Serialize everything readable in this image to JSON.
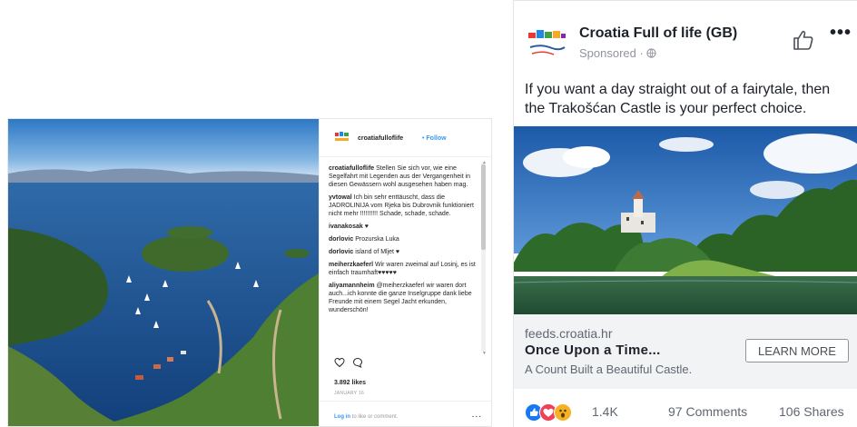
{
  "instagram": {
    "username": "croatiafulloflife",
    "follow_label": "Follow",
    "comments": [
      {
        "user": "croatiafulloflife",
        "text": "Stellen Sie sich vor, wie eine Segelfahrt mit Legenden aus der Vergangenheit in diesen Gewässern wohl ausgesehen haben mag."
      },
      {
        "user": "yvtowal",
        "text": "Ich bin sehr enttäuscht, dass die JADROLINIJA vom Rjeka bis Dubrovnik funktioniert nicht mehr !!!!!!!!!! Schade, schade, schade."
      },
      {
        "user": "ivanakosak",
        "text": "♥"
      },
      {
        "user": "dorlovic",
        "text": "Prozurska Luka"
      },
      {
        "user": "dorlovic",
        "text": "island of Mljet ♥"
      },
      {
        "user": "meiherzkaeferl",
        "text": "Wir waren zweimal auf Losinj, es ist einfach traumhaft♥♥♥♥♥"
      },
      {
        "user": "aliyamannheim",
        "text": "@meiherzkaeferl wir waren dort auch...ich konnte die ganze Inselgruppe dank liebe Freunde mit einem Segel Jacht erkunden, wunderschön!"
      }
    ],
    "likes": "3.892 likes",
    "date": "JANUARY 16",
    "login_link": "Log in",
    "login_rest": " to like or comment.",
    "more": "..."
  },
  "facebook": {
    "page_name": "Croatia Full of life (GB)",
    "sponsored": "Sponsored · ",
    "post_text": "If you want a day straight out of a fairytale, then the Trakošćan Castle is your perfect choice.",
    "link_domain": "feeds.croatia.hr",
    "link_headline": "Once Upon a Time...",
    "link_description": "A Count Built a Beautiful Castle.",
    "cta_label": "LEARN MORE",
    "reaction_count": "1.4K",
    "comments_count": "97 Comments",
    "shares_count": "106 Shares",
    "menu": "•••"
  },
  "colors": {
    "ig_link": "#3897f0",
    "fb_grey": "#606770",
    "fb_like_blue": "#1877f2",
    "fb_love_red": "#f33e58",
    "fb_wow_yellow": "#f7b125"
  },
  "icons": [
    "croatia-logo-icon",
    "heart-outline-icon",
    "comment-bubble-icon",
    "thumbs-up-icon",
    "globe-icon",
    "like-reaction-icon",
    "love-reaction-icon",
    "wow-reaction-icon",
    "more-options-icon"
  ]
}
